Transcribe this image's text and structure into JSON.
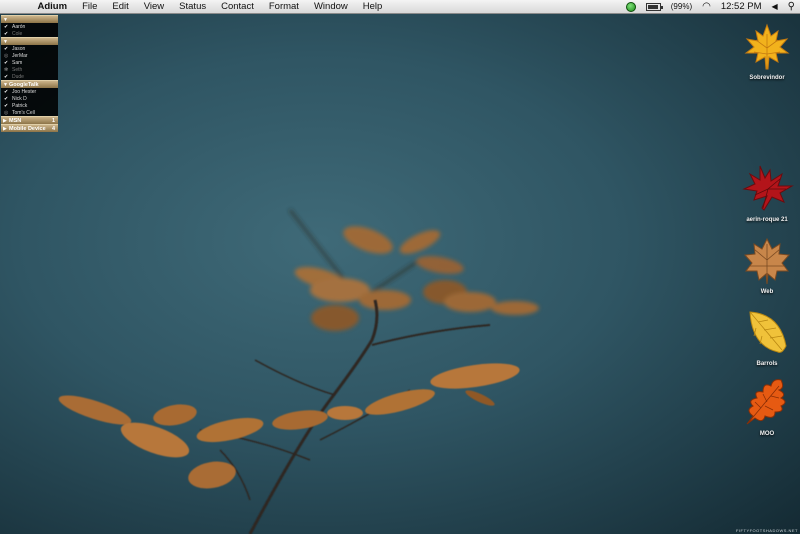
{
  "menubar": {
    "app_name": "Adium",
    "menus": [
      "File",
      "Edit",
      "View",
      "Status",
      "Contact",
      "Format",
      "Window",
      "Help"
    ],
    "apple_glyph": "",
    "battery_text": "(99%)",
    "clock": "12:52 PM",
    "volume_glyph": "◀",
    "spotlight_glyph": "⚲",
    "wifi_glyph": "◠",
    "icons": [
      "apple-icon",
      "adium-status-icon",
      "battery-icon",
      "wifi-icon",
      "volume-icon",
      "spotlight-icon"
    ]
  },
  "contact_list": {
    "groups": [
      {
        "name": "",
        "expanded": true,
        "contacts": [
          {
            "name": "Aarón",
            "status": "online"
          },
          {
            "name": "Cole",
            "status": "idle"
          }
        ]
      },
      {
        "name": "",
        "expanded": true,
        "contacts": [
          {
            "name": "Jason",
            "status": "online"
          },
          {
            "name": "JerMar",
            "status": "away"
          },
          {
            "name": "Sam",
            "status": "online"
          },
          {
            "name": "Seth",
            "status": "idle"
          },
          {
            "name": "Dude",
            "status": "idle"
          }
        ]
      },
      {
        "name": "GoogleTalk",
        "expanded": true,
        "contacts": [
          {
            "name": "Joo Hester",
            "status": "online"
          },
          {
            "name": "Nick D",
            "status": "online"
          },
          {
            "name": "Patrick",
            "status": "online"
          },
          {
            "name": "Tom's Cell",
            "status": "away"
          }
        ]
      },
      {
        "name": "MSN",
        "expanded": false,
        "count": "1",
        "contacts": []
      },
      {
        "name": "Mobile Device",
        "expanded": false,
        "count": "4",
        "contacts": []
      }
    ]
  },
  "desktop_icons": [
    {
      "label": "Sobrevindor",
      "icon": "yellow-maple-leaf-icon",
      "color": "#f2b21c"
    },
    {
      "label": "aerin-roque 21",
      "icon": "red-maple-leaf-icon",
      "color": "#b3141a"
    },
    {
      "label": "Web",
      "icon": "brown-maple-leaf-icon",
      "color": "#b8763f"
    },
    {
      "label": "Barrols",
      "icon": "yellow-elm-leaf-icon",
      "color": "#f0c23a"
    },
    {
      "label": "MOO",
      "icon": "orange-oak-leaf-icon",
      "color": "#e65a12"
    }
  ],
  "credit": "FIFTYFOOTSHADOWS.NET",
  "colors": {
    "wallpaper": "#2f5563",
    "leaf": "#b7773a",
    "group_header": "#a88c58"
  }
}
